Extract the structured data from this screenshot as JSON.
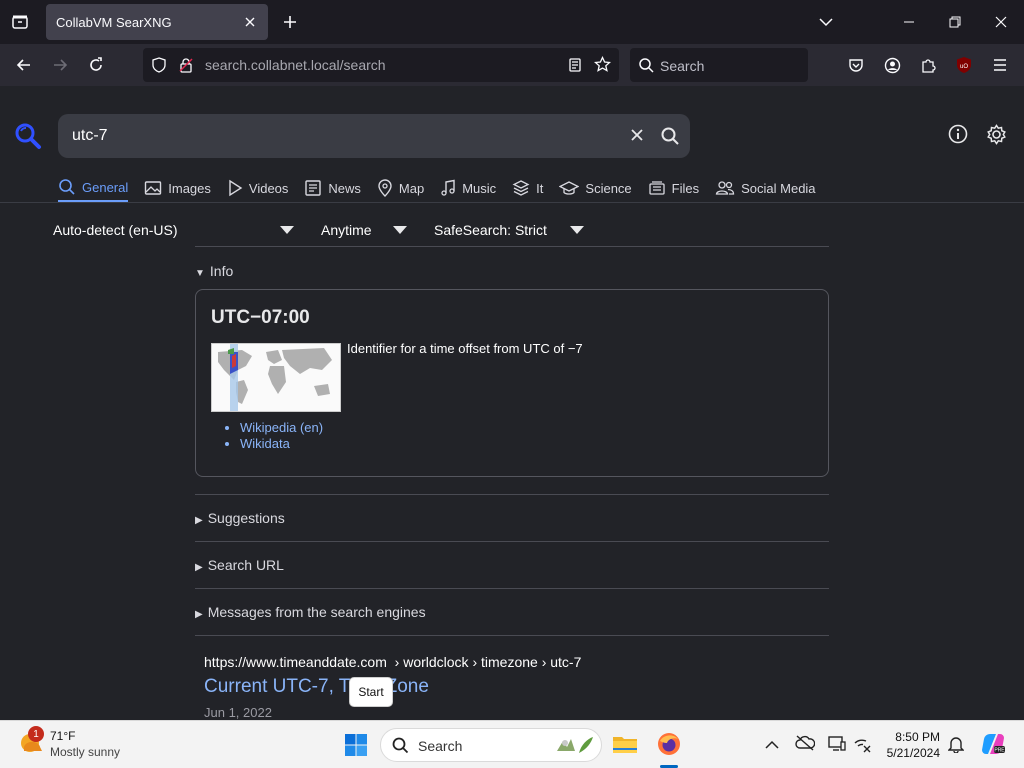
{
  "browser": {
    "tab_title": "CollabVM SearXNG",
    "url_host": "search.collabnet.local",
    "url_path": "/search",
    "search_placeholder": "Search"
  },
  "search": {
    "query": "utc-7"
  },
  "categories": [
    {
      "label": "General",
      "icon": "search-icon",
      "active": true
    },
    {
      "label": "Images",
      "icon": "image-icon"
    },
    {
      "label": "Videos",
      "icon": "play-icon"
    },
    {
      "label": "News",
      "icon": "newspaper-icon"
    },
    {
      "label": "Map",
      "icon": "map-pin-icon"
    },
    {
      "label": "Music",
      "icon": "music-icon"
    },
    {
      "label": "It",
      "icon": "layers-icon"
    },
    {
      "label": "Science",
      "icon": "graduation-cap-icon"
    },
    {
      "label": "Files",
      "icon": "files-icon"
    },
    {
      "label": "Social Media",
      "icon": "people-icon"
    }
  ],
  "filters": {
    "language": "Auto-detect (en-US)",
    "time": "Anytime",
    "safesearch": "SafeSearch: Strict"
  },
  "sections": {
    "info": "Info",
    "suggestions": "Suggestions",
    "search_url": "Search URL",
    "messages": "Messages from the search engines"
  },
  "infobox": {
    "title": "UTC−07:00",
    "description": "Identifier for a time offset from UTC of −7",
    "links": [
      "Wikipedia (en)",
      "Wikidata"
    ]
  },
  "result": {
    "url": "https://www.timeanddate.com",
    "breadcrumb": "› worldclock › timezone › utc-7",
    "title": "Current UTC-7, Time Zone",
    "date": "Jun 1, 2022"
  },
  "tooltip": "Start",
  "taskbar": {
    "weather_temp": "71°F",
    "weather_cond": "Mostly sunny",
    "weather_badge": "1",
    "search_placeholder": "Search",
    "time": "8:50 PM",
    "date": "5/21/2024"
  },
  "colors": {
    "accent": "#6b9dfa",
    "link": "#8ab4f8"
  }
}
